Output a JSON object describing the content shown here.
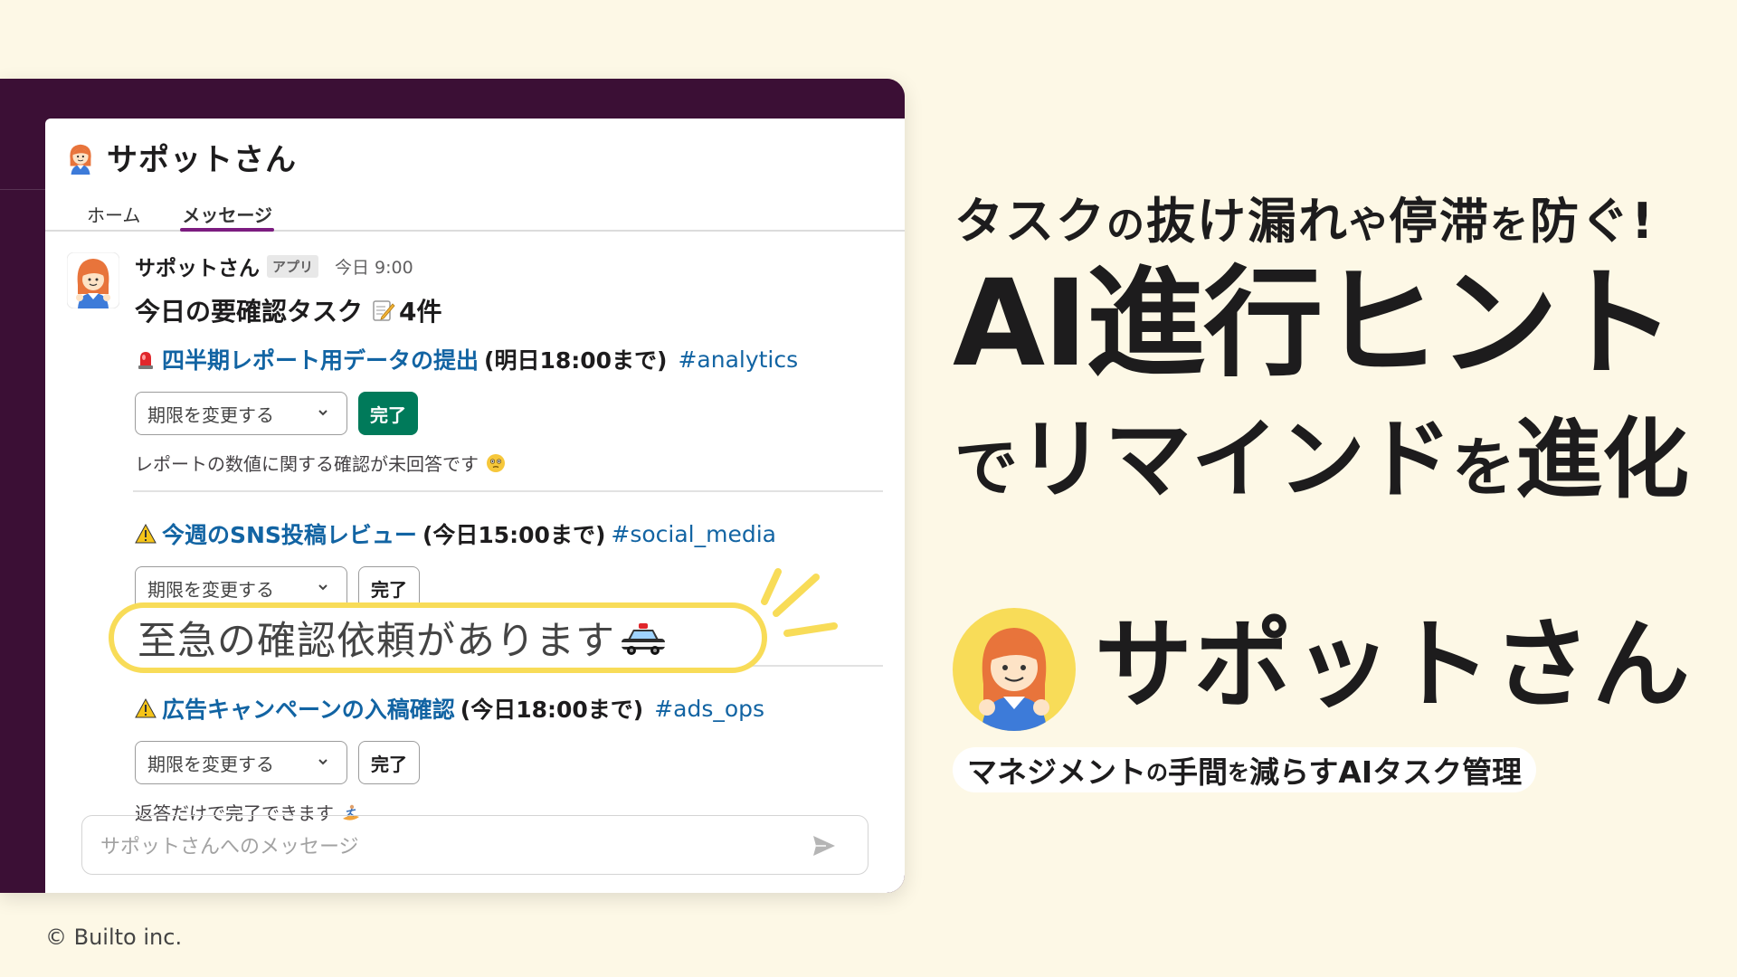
{
  "window": {
    "header_title": "サポットさん",
    "tabs": [
      {
        "label": "ホーム",
        "active": false
      },
      {
        "label": "メッセージ",
        "active": true
      }
    ]
  },
  "message": {
    "sender": "サポットさん",
    "badge": "アプリ",
    "timestamp": "今日 9:00",
    "heading_text": "今日の要確認タスク",
    "heading_count": "4件",
    "tasks": [
      {
        "icon": "siren-icon",
        "title": "四半期レポート用データの提出",
        "deadline": "(明日18:00まで)",
        "channel": "#analytics",
        "select_label": "期限を変更する",
        "done_label": "完了",
        "done_style": "primary",
        "note": "レポートの数値に関する確認が未回答です"
      },
      {
        "icon": "warning-icon",
        "title": "今週のSNS投稿レビュー",
        "deadline": "(今日15:00まで)",
        "channel": "#social_media",
        "select_label": "期限を変更する",
        "done_label": "完了",
        "done_style": "outline",
        "note": ""
      },
      {
        "icon": "warning-icon",
        "title": "広告キャンペーンの入稿確認",
        "deadline": "(今日18:00まで)",
        "channel": "#ads_ops",
        "select_label": "期限を変更する",
        "done_label": "完了",
        "done_style": "outline",
        "note": "返答だけで完了できます"
      }
    ]
  },
  "composer": {
    "placeholder": "サポットさんへのメッセージ"
  },
  "callout": {
    "text": "至急の確認依頼があります"
  },
  "hero": {
    "tagline_1": "タスク",
    "tagline_2": "の",
    "tagline_3": "抜け漏れ",
    "tagline_4": "や",
    "tagline_5": "停滞",
    "tagline_6": "を",
    "tagline_7": "防ぐ!",
    "headline": "AI進行ヒント",
    "sub_1": "で",
    "sub_2": "リマインド",
    "sub_3": "を",
    "sub_4": "進化"
  },
  "brand": {
    "name": "サポットさん",
    "pill_1": "マネジメント",
    "pill_2": "の",
    "pill_3": "手間",
    "pill_4": "を",
    "pill_5": "減らすAIタスク管理"
  },
  "footer": {
    "copyright": "© Builto inc."
  },
  "colors": {
    "background": "#fdf8e6",
    "aubergine": "#3b0f35",
    "link": "#1264a3",
    "done_green": "#007a5a",
    "highlight_yellow": "#f8dc58",
    "tab_underline": "#7c1c80"
  }
}
